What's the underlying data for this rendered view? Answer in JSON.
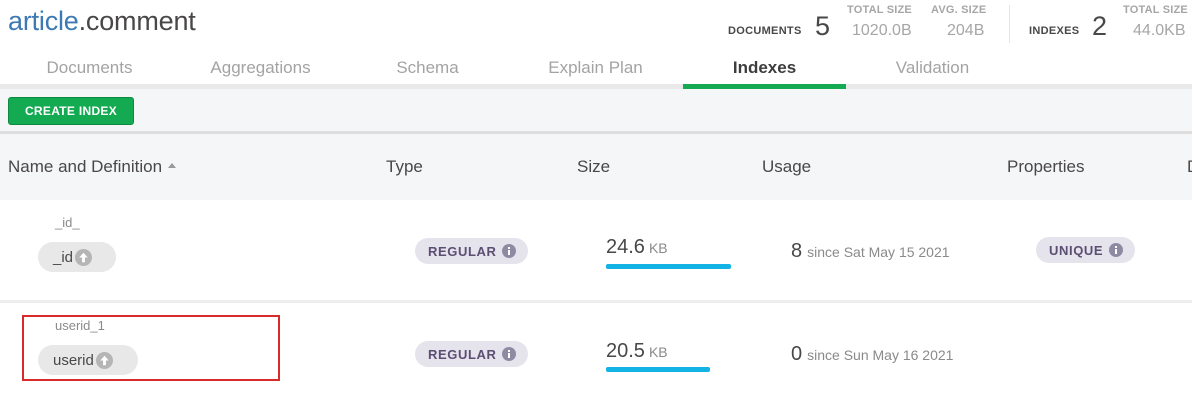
{
  "header": {
    "db_name": "article",
    "collection_name": ".comment",
    "documents": {
      "label": "DOCUMENTS",
      "count": "5"
    },
    "doc_total_size": {
      "label": "TOTAL SIZE",
      "value": "1020.0B"
    },
    "doc_avg_size": {
      "label": "AVG. SIZE",
      "value": "204B"
    },
    "indexes": {
      "label": "INDEXES",
      "count": "2"
    },
    "idx_total_size": {
      "label": "TOTAL SIZE",
      "value": "44.0KB"
    }
  },
  "tabs": [
    {
      "label": "Documents",
      "active": false
    },
    {
      "label": "Aggregations",
      "active": false
    },
    {
      "label": "Schema",
      "active": false
    },
    {
      "label": "Explain Plan",
      "active": false
    },
    {
      "label": "Indexes",
      "active": true
    },
    {
      "label": "Validation",
      "active": false
    }
  ],
  "toolbar": {
    "create_index_label": "CREATE INDEX"
  },
  "table": {
    "columns": [
      "Name and Definition",
      "Type",
      "Size",
      "Usage",
      "Properties",
      "D"
    ],
    "sorted_column": "Name and Definition",
    "rows": [
      {
        "name": "_id_",
        "field": "_id",
        "type": "REGULAR",
        "size_value": "24.6",
        "size_unit": "KB",
        "size_fraction": 1.0,
        "usage_count": "8",
        "usage_since": "since Sat May 15 2021",
        "property": "UNIQUE"
      },
      {
        "name": "userid_1",
        "field": "userid",
        "type": "REGULAR",
        "size_value": "20.5",
        "size_unit": "KB",
        "size_fraction": 0.83,
        "usage_count": "0",
        "usage_since": "since Sun May 16 2021",
        "property": ""
      }
    ]
  },
  "colors": {
    "accent_green": "#13aa52",
    "size_bar": "#13b3e6",
    "highlight": "#d92b2b",
    "db_name": "#3d7ab3"
  }
}
